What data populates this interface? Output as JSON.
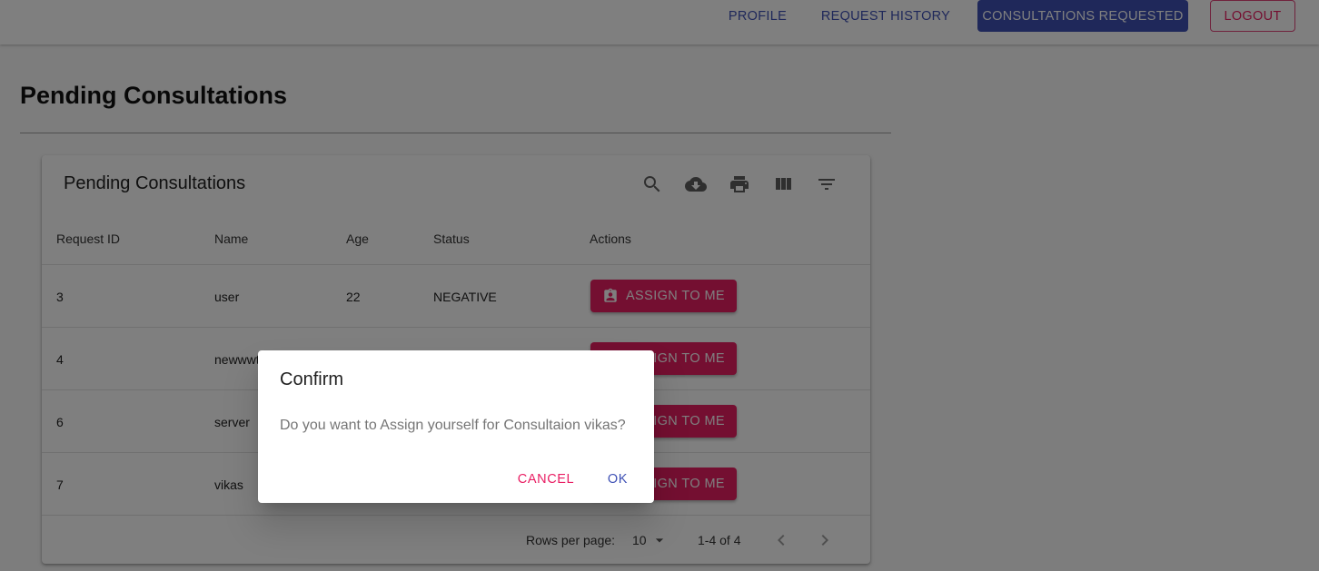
{
  "nav": {
    "profile": "PROFILE",
    "history": "REQUEST HISTORY",
    "consultations": "CONSULTATIONS REQUESTED",
    "logout": "LOGOUT"
  },
  "page": {
    "title": "Pending Consultations"
  },
  "table": {
    "title": "Pending Consultations",
    "toolbar_icons": [
      "search-icon",
      "cloud-download-icon",
      "print-icon",
      "view-column-icon",
      "filter-list-icon"
    ],
    "columns": [
      "Request ID",
      "Name",
      "Age",
      "Status",
      "Actions"
    ],
    "rows": [
      {
        "id": "3",
        "name": "user",
        "age": "22",
        "status": "NEGATIVE",
        "action": "ASSIGN TO ME"
      },
      {
        "id": "4",
        "name": "newwwt",
        "age": "",
        "status": "",
        "action": "ASSIGN TO ME"
      },
      {
        "id": "6",
        "name": "server",
        "age": "",
        "status": "",
        "action": "ASSIGN TO ME"
      },
      {
        "id": "7",
        "name": "vikas",
        "age": "",
        "status": "",
        "action": "ASSIGN TO ME"
      }
    ],
    "footer": {
      "rows_per_page_label": "Rows per page:",
      "rows_per_page_value": "10",
      "range": "1-4 of 4"
    }
  },
  "dialog": {
    "title": "Confirm",
    "message": "Do you want to Assign yourself for Consultaion vikas?",
    "cancel": "CANCEL",
    "ok": "OK"
  },
  "colors": {
    "primary": "#3f51b5",
    "secondary": "#e91e63",
    "backdrop": "rgba(0,0,0,0.5)"
  }
}
